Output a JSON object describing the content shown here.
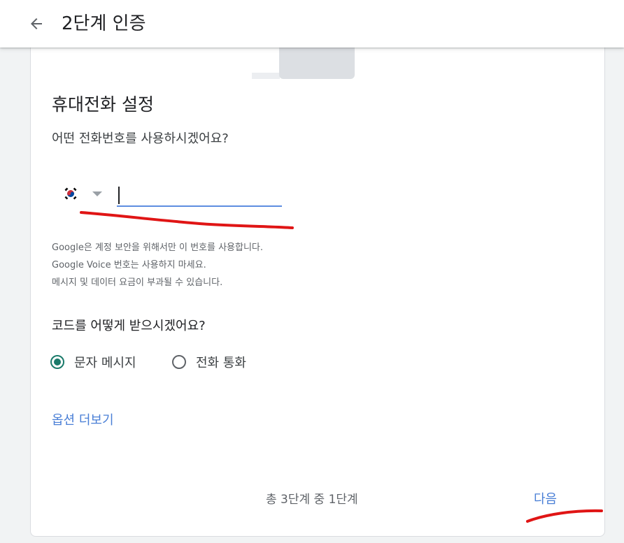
{
  "header": {
    "title": "2단계 인증",
    "back_icon": "arrow-back-icon"
  },
  "main": {
    "section_title": "휴대전화 설정",
    "phone_question": "어떤 전화번호를 사용하시겠어요?",
    "country": {
      "flag_icon": "south-korea-flag-icon",
      "dropdown_icon": "caret-down-icon"
    },
    "phone_input": {
      "value": "",
      "placeholder": ""
    },
    "info_lines": [
      "Google은 계정 보안을 위해서만 이 번호를 사용합니다.",
      "Google Voice 번호는 사용하지 마세요.",
      "메시지 및 데이터 요금이 부과될 수 있습니다."
    ],
    "code_question": "코드를 어떻게 받으시겠어요?",
    "options": [
      {
        "label": "문자 메시지",
        "selected": true
      },
      {
        "label": "전화 통화",
        "selected": false
      }
    ],
    "more_options": "옵션 더보기"
  },
  "footer": {
    "step_text": "총 3단계 중 1단계",
    "next_label": "다음"
  },
  "colors": {
    "accent_blue": "#4a7fd6",
    "radio_selected": "#1a7a6a",
    "annotation_red": "#e01515"
  }
}
